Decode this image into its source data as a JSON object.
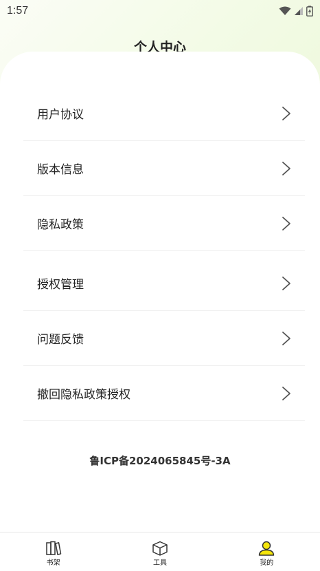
{
  "status_bar": {
    "time": "1:57"
  },
  "header": {
    "title": "个人中心"
  },
  "menu": {
    "items": [
      {
        "label": "用户协议"
      },
      {
        "label": "版本信息"
      },
      {
        "label": "隐私政策"
      },
      {
        "label": "授权管理"
      },
      {
        "label": "问题反馈"
      },
      {
        "label": "撤回隐私政策授权"
      }
    ]
  },
  "footer": {
    "icp": "鲁ICP备2024065845号-3A"
  },
  "tabbar": {
    "tabs": [
      {
        "label": "书架",
        "icon": "bookshelf-icon"
      },
      {
        "label": "工具",
        "icon": "cube-icon"
      },
      {
        "label": "我的",
        "icon": "user-icon",
        "active": true
      }
    ],
    "active_color": "#f5e60a"
  }
}
